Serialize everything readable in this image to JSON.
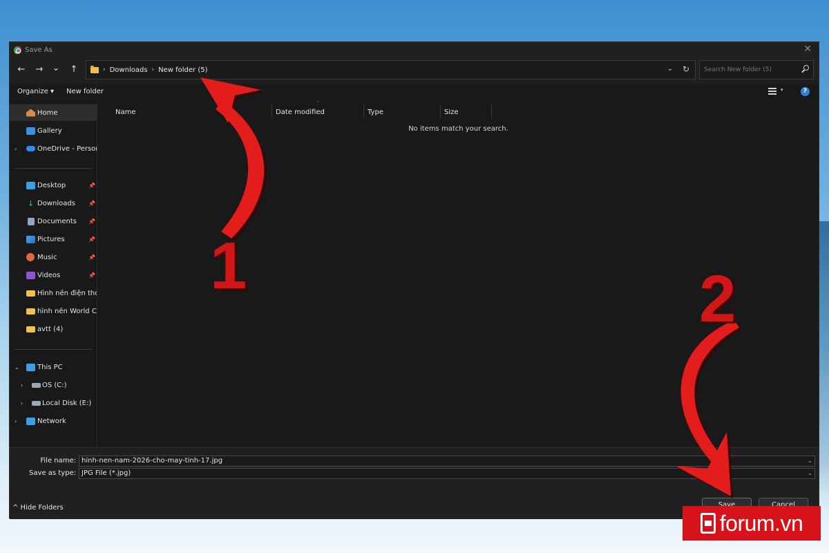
{
  "window": {
    "title": "Save As",
    "close_glyph": "✕"
  },
  "nav": {
    "back": "←",
    "forward": "→",
    "recent": "⌄",
    "up": "↑"
  },
  "address": {
    "breadcrumbs": [
      "Downloads",
      "New folder (5)"
    ],
    "separator": "›",
    "dropdown": "⌄",
    "refresh": "↻"
  },
  "search": {
    "placeholder": "Search New folder (5)"
  },
  "toolbar": {
    "organize": "Organize ▾",
    "new_folder": "New folder",
    "view_drop": "▾",
    "help": "?"
  },
  "sidebar": {
    "items": [
      {
        "label": "Home",
        "icon": "home-icon",
        "selected": true
      },
      {
        "label": "Gallery",
        "icon": "gallery-icon"
      },
      {
        "label": "OneDrive - Persona",
        "icon": "onedrive-icon",
        "expand": "›"
      },
      {
        "label": "Desktop",
        "icon": "desktop-icon",
        "pinned": true
      },
      {
        "label": "Downloads",
        "icon": "downloads-icon",
        "pinned": true
      },
      {
        "label": "Documents",
        "icon": "documents-icon",
        "pinned": true
      },
      {
        "label": "Pictures",
        "icon": "pictures-icon",
        "pinned": true
      },
      {
        "label": "Music",
        "icon": "music-icon",
        "pinned": true
      },
      {
        "label": "Videos",
        "icon": "videos-icon",
        "pinned": true
      },
      {
        "label": "Hình nền điện thoa",
        "icon": "folder-icon"
      },
      {
        "label": "hình nền World Cup",
        "icon": "folder-icon"
      },
      {
        "label": "avtt (4)",
        "icon": "folder-icon"
      },
      {
        "label": "This PC",
        "icon": "this-pc-icon",
        "expand": "⌄"
      },
      {
        "label": "OS (C:)",
        "icon": "drive-c-icon",
        "expand": "›"
      },
      {
        "label": "Local Disk (E:)",
        "icon": "drive-e-icon",
        "expand": "›"
      },
      {
        "label": "Network",
        "icon": "network-icon",
        "expand": "›"
      }
    ],
    "pin_glyph": "📌"
  },
  "columns": [
    "Name",
    "Date modified",
    "Type",
    "Size"
  ],
  "sort_caret": "⌃",
  "empty_message": "No items match your search.",
  "form": {
    "file_name_label": "File name:",
    "file_name_value": "hinh-nen-nam-2026-cho-may-tinh-17.jpg",
    "type_label": "Save as type:",
    "type_value": "JPG File (*.jpg)",
    "dropdown": "⌄"
  },
  "footer": {
    "hide_folders": "^  Hide Folders",
    "save": "Save",
    "cancel": "Cancel"
  },
  "annotations": {
    "step1": "1",
    "step2": "2"
  },
  "brand": {
    "logo_text": "forum.vn",
    "accent": "#d11717"
  }
}
